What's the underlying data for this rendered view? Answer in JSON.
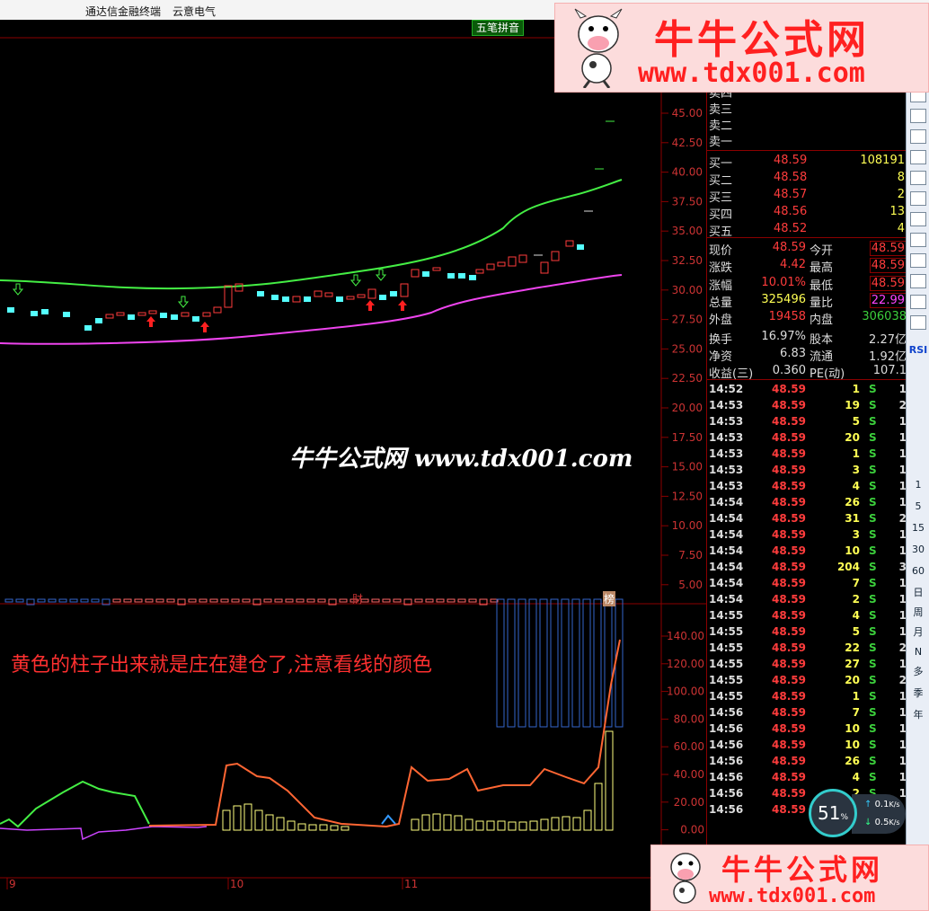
{
  "titlebar": {
    "app_name": "通达信金融终端",
    "stock_name": "云意电气"
  },
  "toolbar_chip": {
    "label": "五笔拼音"
  },
  "watermark": {
    "text": "牛牛公式网 www.tdx001.com"
  },
  "banner": {
    "title": "牛牛公式网",
    "url": "www.tdx001.com"
  },
  "annotation": {
    "text": "黄色的柱子出来就是庄在建仓了,注意看线的颜色"
  },
  "price_axis": [
    "45.00",
    "42.50",
    "40.00",
    "37.50",
    "35.00",
    "32.50",
    "30.00",
    "27.50",
    "25.00",
    "22.50",
    "20.00",
    "17.50",
    "15.00",
    "12.50",
    "10.00",
    "7.50",
    "5.00"
  ],
  "indicator_axis": [
    "140.00",
    "120.00",
    "100.00",
    "80.00",
    "60.00",
    "40.00",
    "20.00",
    "0.00"
  ],
  "x_axis": [
    "9",
    "10",
    "11"
  ],
  "markers": {
    "cai": "财",
    "bang": "榜"
  },
  "order_book": {
    "sells": [
      {
        "label": "卖四"
      },
      {
        "label": "卖三"
      },
      {
        "label": "卖二"
      },
      {
        "label": "卖一"
      }
    ],
    "buys": [
      {
        "label": "买一",
        "price": "48.59",
        "vol": "108191"
      },
      {
        "label": "买二",
        "price": "48.58",
        "vol": "8"
      },
      {
        "label": "买三",
        "price": "48.57",
        "vol": "2"
      },
      {
        "label": "买四",
        "price": "48.56",
        "vol": "13"
      },
      {
        "label": "买五",
        "price": "48.52",
        "vol": "4"
      }
    ]
  },
  "quote": {
    "r1": {
      "a": "现价",
      "av": "48.59",
      "b": "今开",
      "bv": "48.59"
    },
    "r2": {
      "a": "涨跌",
      "av": "4.42",
      "b": "最高",
      "bv": "48.59"
    },
    "r3": {
      "a": "涨幅",
      "av": "10.01%",
      "b": "最低",
      "bv": "48.59"
    },
    "r4": {
      "a": "总量",
      "av": "325496",
      "b": "量比",
      "bv": "22.99"
    },
    "r5": {
      "a": "外盘",
      "av": "19458",
      "b": "内盘",
      "bv": "306038"
    },
    "r6": {
      "a": "换手",
      "av": "16.97%",
      "b": "股本",
      "bv": "2.27亿"
    },
    "r7": {
      "a": "净资",
      "av": "6.83",
      "b": "流通",
      "bv": "1.92亿"
    },
    "r8": {
      "a": "收益(三)",
      "av": "0.360",
      "b": "PE(动)",
      "bv": "107.1"
    }
  },
  "ticks": [
    {
      "t": "14:52",
      "p": "48.59",
      "v": "1",
      "s": "S",
      "n": "1"
    },
    {
      "t": "14:53",
      "p": "48.59",
      "v": "19",
      "s": "S",
      "n": "2"
    },
    {
      "t": "14:53",
      "p": "48.59",
      "v": "5",
      "s": "S",
      "n": "1"
    },
    {
      "t": "14:53",
      "p": "48.59",
      "v": "20",
      "s": "S",
      "n": "1"
    },
    {
      "t": "14:53",
      "p": "48.59",
      "v": "1",
      "s": "S",
      "n": "1"
    },
    {
      "t": "14:53",
      "p": "48.59",
      "v": "3",
      "s": "S",
      "n": "1"
    },
    {
      "t": "14:53",
      "p": "48.59",
      "v": "4",
      "s": "S",
      "n": "1"
    },
    {
      "t": "14:54",
      "p": "48.59",
      "v": "26",
      "s": "S",
      "n": "1"
    },
    {
      "t": "14:54",
      "p": "48.59",
      "v": "31",
      "s": "S",
      "n": "2"
    },
    {
      "t": "14:54",
      "p": "48.59",
      "v": "3",
      "s": "S",
      "n": "1"
    },
    {
      "t": "14:54",
      "p": "48.59",
      "v": "10",
      "s": "S",
      "n": "1"
    },
    {
      "t": "14:54",
      "p": "48.59",
      "v": "204",
      "s": "S",
      "n": "3"
    },
    {
      "t": "14:54",
      "p": "48.59",
      "v": "7",
      "s": "S",
      "n": "1"
    },
    {
      "t": "14:54",
      "p": "48.59",
      "v": "2",
      "s": "S",
      "n": "1"
    },
    {
      "t": "14:55",
      "p": "48.59",
      "v": "4",
      "s": "S",
      "n": "1"
    },
    {
      "t": "14:55",
      "p": "48.59",
      "v": "5",
      "s": "S",
      "n": "1"
    },
    {
      "t": "14:55",
      "p": "48.59",
      "v": "22",
      "s": "S",
      "n": "2"
    },
    {
      "t": "14:55",
      "p": "48.59",
      "v": "27",
      "s": "S",
      "n": "1"
    },
    {
      "t": "14:55",
      "p": "48.59",
      "v": "20",
      "s": "S",
      "n": "2"
    },
    {
      "t": "14:55",
      "p": "48.59",
      "v": "1",
      "s": "S",
      "n": "1"
    },
    {
      "t": "14:56",
      "p": "48.59",
      "v": "7",
      "s": "S",
      "n": "1"
    },
    {
      "t": "14:56",
      "p": "48.59",
      "v": "10",
      "s": "S",
      "n": "1"
    },
    {
      "t": "14:56",
      "p": "48.59",
      "v": "10",
      "s": "S",
      "n": "1"
    },
    {
      "t": "14:56",
      "p": "48.59",
      "v": "26",
      "s": "S",
      "n": "1"
    },
    {
      "t": "14:56",
      "p": "48.59",
      "v": "4",
      "s": "S",
      "n": "1"
    },
    {
      "t": "14:56",
      "p": "48.59",
      "v": "2",
      "s": "S",
      "n": "1"
    },
    {
      "t": "14:56",
      "p": "48.59",
      "v": "",
      "s": "",
      "n": ""
    }
  ],
  "toolbar_right": [
    "RSI",
    "1",
    "5",
    "15",
    "30",
    "60",
    "日",
    "周",
    "月",
    "N",
    "多",
    "季",
    "年"
  ],
  "net_widget": {
    "percent": "51",
    "unit": "%",
    "up": "0.1",
    "down": "0.5",
    "rate_unit": "K/s"
  },
  "colors": {
    "up_red": "#ff3c3c",
    "down_cyan": "#54ffff",
    "upper_band": "#44ee44",
    "lower_band": "#ee44ee",
    "bar_yellow": "#ffff80"
  }
}
